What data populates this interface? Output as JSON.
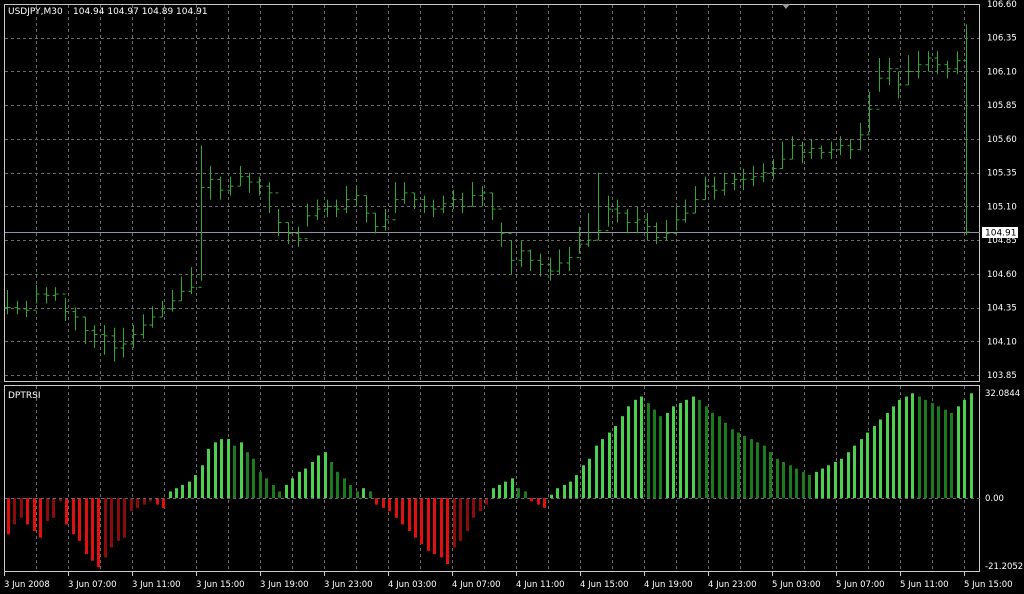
{
  "main_chart": {
    "symbol_label": "USDJPY,M30",
    "ohlc_label": "104.94 104.97 104.89 104.91",
    "current_price_label": "104.91",
    "price_ticks": [
      "106.60",
      "106.35",
      "106.10",
      "105.85",
      "105.60",
      "105.35",
      "105.10",
      "104.85",
      "104.60",
      "104.35",
      "104.10",
      "103.85"
    ]
  },
  "indicator": {
    "name": "DPTRSI",
    "ticks": [
      "32.0844",
      "0.00",
      "-21.2052"
    ]
  },
  "time_axis": {
    "labels": [
      "3 Jun 2008",
      "3 Jun 07:00",
      "3 Jun 11:00",
      "3 Jun 15:00",
      "3 Jun 19:00",
      "3 Jun 23:00",
      "4 Jun 03:00",
      "4 Jun 07:00",
      "4 Jun 11:00",
      "4 Jun 15:00",
      "4 Jun 19:00",
      "4 Jun 23:00",
      "5 Jun 03:00",
      "5 Jun 07:00",
      "5 Jun 11:00",
      "5 Jun 15:00"
    ]
  },
  "colors": {
    "background": "#000000",
    "grid": "#6b6b6b",
    "bars": "#2fa82f",
    "hist_up_light": "#4fcf4f",
    "hist_up_dark": "#1e7a1e",
    "hist_down_light": "#e01010",
    "hist_down_dark": "#8a0b0b",
    "frame": "#c8c8c8",
    "bid_line": "#8b94a8"
  },
  "chart_data": [
    {
      "type": "ohlc",
      "series_label": "USDJPY,M30",
      "ylim": [
        103.8,
        106.62
      ],
      "current": 104.91,
      "close": [
        104.35,
        104.34,
        104.33,
        104.45,
        104.44,
        104.45,
        104.32,
        104.28,
        104.18,
        104.15,
        104.14,
        104.05,
        104.08,
        104.15,
        104.22,
        104.28,
        104.34,
        104.4,
        104.47,
        104.5,
        105.24,
        105.3,
        105.22,
        105.25,
        105.32,
        105.28,
        105.25,
        105.2,
        104.98,
        104.9,
        104.86,
        105.03,
        105.08,
        105.1,
        105.08,
        105.15,
        105.18,
        105.05,
        104.95,
        105.0,
        105.15,
        105.2,
        105.15,
        105.1,
        105.08,
        105.12,
        105.15,
        105.1,
        105.18,
        105.2,
        105.08,
        104.9,
        104.7,
        104.77,
        104.7,
        104.67,
        104.62,
        104.68,
        104.72,
        104.82,
        104.85,
        104.92,
        105.08,
        105.05,
        104.98,
        105.0,
        104.95,
        104.87,
        104.9,
        105.0,
        105.05,
        105.15,
        105.25,
        105.22,
        105.27,
        105.3,
        105.3,
        105.32,
        105.35,
        105.38,
        105.45,
        105.55,
        105.5,
        105.53,
        105.5,
        105.52,
        105.55,
        105.52,
        105.63,
        105.82,
        106.05,
        106.12,
        106.0,
        106.1,
        106.15,
        106.2,
        106.15,
        106.12,
        106.18,
        104.91
      ],
      "high": [
        104.48,
        104.4,
        104.4,
        104.52,
        104.5,
        104.5,
        104.42,
        104.35,
        104.28,
        104.22,
        104.22,
        104.2,
        104.2,
        104.22,
        104.3,
        104.36,
        104.4,
        104.48,
        104.58,
        104.65,
        105.55,
        105.4,
        105.32,
        105.32,
        105.4,
        105.35,
        105.32,
        105.28,
        105.08,
        104.98,
        104.95,
        105.12,
        105.15,
        105.15,
        105.15,
        105.25,
        105.25,
        105.18,
        105.05,
        105.08,
        105.28,
        105.28,
        105.2,
        105.18,
        105.15,
        105.18,
        105.22,
        105.2,
        105.28,
        105.25,
        105.2,
        104.98,
        104.85,
        104.85,
        104.78,
        104.75,
        104.72,
        104.78,
        104.8,
        104.95,
        105.05,
        105.35,
        105.18,
        105.15,
        105.08,
        105.1,
        105.05,
        104.98,
        105.0,
        105.1,
        105.15,
        105.25,
        105.32,
        105.32,
        105.35,
        105.35,
        105.38,
        105.4,
        105.42,
        105.45,
        105.58,
        105.62,
        105.58,
        105.6,
        105.55,
        105.58,
        105.62,
        105.6,
        105.72,
        105.95,
        106.2,
        106.2,
        106.1,
        106.22,
        106.25,
        106.25,
        106.25,
        106.18,
        106.25,
        106.45
      ],
      "low": [
        104.3,
        104.3,
        104.28,
        104.38,
        104.38,
        104.4,
        104.25,
        104.18,
        104.08,
        104.05,
        104.0,
        103.95,
        103.98,
        104.05,
        104.12,
        104.2,
        104.28,
        104.32,
        104.4,
        104.45,
        104.55,
        105.15,
        105.15,
        105.18,
        105.25,
        105.2,
        105.18,
        105.05,
        104.88,
        104.82,
        104.8,
        104.95,
        105.0,
        105.02,
        105.02,
        105.05,
        105.1,
        104.98,
        104.9,
        104.92,
        105.05,
        105.12,
        105.08,
        105.05,
        105.02,
        105.05,
        105.08,
        105.05,
        105.1,
        105.1,
        105.0,
        104.8,
        104.6,
        104.65,
        104.62,
        104.58,
        104.55,
        104.6,
        104.62,
        104.75,
        104.8,
        104.85,
        104.95,
        104.98,
        104.9,
        104.9,
        104.85,
        104.82,
        104.85,
        104.92,
        104.98,
        105.05,
        105.15,
        105.15,
        105.18,
        105.22,
        105.22,
        105.25,
        105.28,
        105.3,
        105.38,
        105.45,
        105.42,
        105.45,
        105.45,
        105.45,
        105.48,
        105.45,
        105.52,
        105.65,
        105.95,
        106.0,
        105.9,
        106.0,
        106.05,
        106.1,
        106.08,
        106.05,
        106.08,
        104.89
      ]
    },
    {
      "type": "histogram",
      "series_label": "DPTRSI",
      "ylim": [
        -21.2052,
        32.0844
      ],
      "values": [
        -11,
        -8,
        -6,
        -8,
        -10,
        -12,
        -7,
        -6,
        -1,
        -8,
        -11,
        -13,
        -17,
        -19,
        -21,
        -18,
        -15,
        -13,
        -12,
        -4,
        -3,
        -2,
        -1,
        -2,
        -3,
        2,
        3,
        4,
        5,
        7,
        10,
        15,
        17,
        18,
        18,
        16,
        17,
        14,
        12,
        8,
        6,
        4,
        2,
        4,
        6,
        8,
        9,
        11,
        13,
        14,
        11,
        8,
        6,
        4,
        2,
        3,
        2,
        -2,
        -3,
        -4,
        -6,
        -8,
        -10,
        -12,
        -14,
        -16,
        -17,
        -18,
        -20,
        -15,
        -13,
        -10,
        -6,
        -4,
        -2,
        3,
        4,
        5,
        6,
        3,
        2,
        -1,
        -2,
        -3,
        1,
        3,
        4,
        5,
        7,
        10,
        12,
        16,
        18,
        20,
        22,
        25,
        28,
        30,
        31,
        29,
        27,
        25,
        26,
        28,
        29,
        30,
        31,
        30,
        28,
        26,
        25,
        23,
        21,
        20,
        19,
        18,
        17,
        16,
        14,
        12,
        11,
        10,
        9,
        8,
        7,
        8,
        9,
        10,
        11,
        12,
        14,
        16,
        18,
        20,
        22,
        24,
        26,
        28,
        30,
        31,
        32,
        31,
        30,
        29,
        28,
        27,
        26,
        28,
        30,
        32
      ]
    }
  ]
}
